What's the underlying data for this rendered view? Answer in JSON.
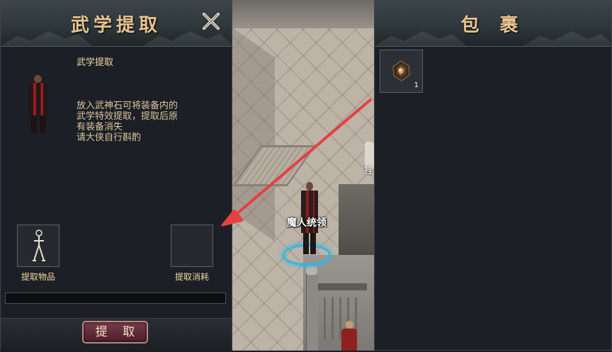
{
  "extract_panel": {
    "title": "武学提取",
    "description_title": "武学提取",
    "description_lines": [
      "放入武神石可将装备内的",
      "武学特效提取，提取后原",
      "有装备消失",
      "请大侠自行斟酌"
    ],
    "item_slot_label": "提取物品",
    "cost_slot_label": "提取消耗",
    "extract_button_label": "提 取",
    "progress_fraction": 0
  },
  "bag_panel": {
    "title": "包 裹",
    "items": [
      {
        "icon": "wushen-stone-icon",
        "count": "1"
      }
    ]
  },
  "world": {
    "npc_name": "魔人统领",
    "partial_label": "挂"
  },
  "colors": {
    "title_gold": "#e8c490",
    "label_gold": "#f0d9a0",
    "arrow_red": "#e64040",
    "ring_blue": "#2fb8e8"
  }
}
